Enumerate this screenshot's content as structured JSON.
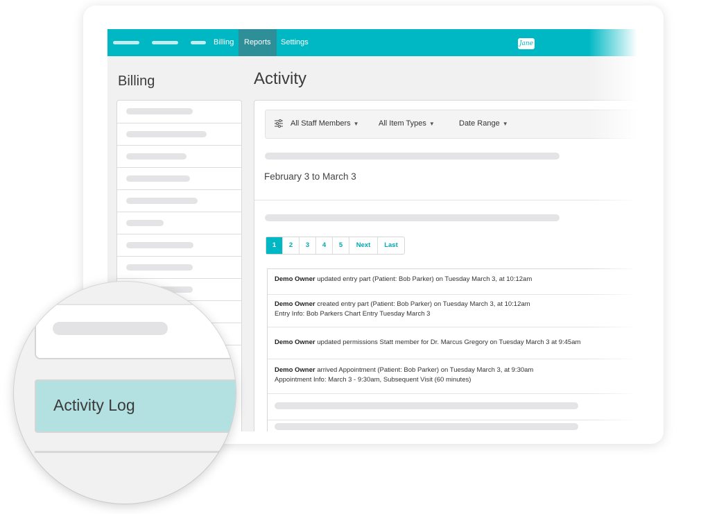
{
  "nav": {
    "links": [
      "Billing",
      "Reports",
      "Settings"
    ],
    "active": "Reports",
    "logo_text": "Jane"
  },
  "sidebar": {
    "title": "Billing"
  },
  "main": {
    "title": "Activity",
    "filters": [
      "All Staff Members",
      "All Item Types",
      "Date Range"
    ],
    "date_range": "February 3 to March 3",
    "pagination": [
      "1",
      "2",
      "3",
      "4",
      "5",
      "Next",
      "Last"
    ],
    "activities": [
      {
        "actor": "Demo Owner",
        "text": "updated entry part (Patient: Bob Parker) on Tuesday March 3, at 10:12am"
      },
      {
        "actor": "Demo Owner",
        "text": "created entry part (Patient: Bob Parker) on Tuesday March 3, at 10:12am",
        "detail": "Entry Info: Bob Parkers Chart Entry Tuesday March 3"
      },
      {
        "actor": "Demo Owner",
        "text": "updated permissions Statt member for Dr. Marcus Gregory on Tuesday March 3 at 9:45am"
      },
      {
        "actor": "Demo Owner",
        "text": "arrived Appointment (Patient: Bob Parker) on Tuesday March 3, at 9:30am",
        "detail": "Appointment Info: March 3 - 9:30am, Subsequent Visit (60 minutes)"
      }
    ]
  },
  "magnifier": {
    "item_label": "Activity Log"
  },
  "colors": {
    "accent": "#00b8c4",
    "nav_active": "#2e8f98",
    "highlight": "#b3e0e1"
  },
  "icons": {
    "filter": "sliders-icon",
    "logo": "jane-logo-icon"
  }
}
